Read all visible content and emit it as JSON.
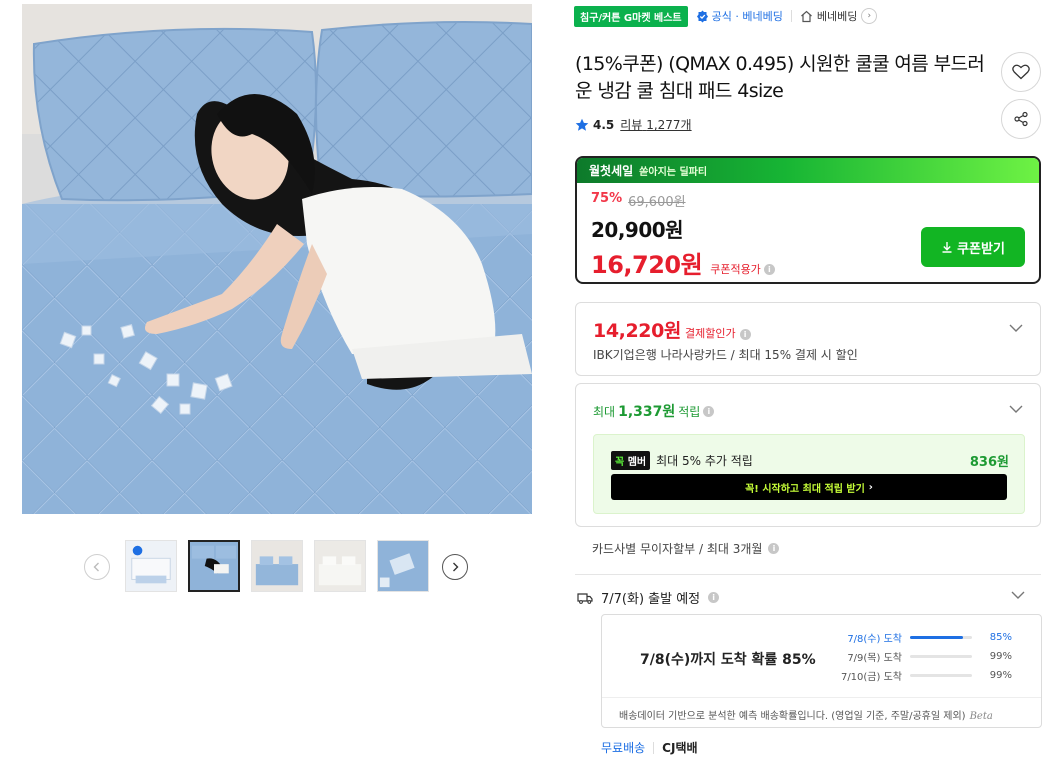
{
  "gallery": {
    "thumb_count": 5,
    "selected_index": 1
  },
  "badges": {
    "best": "침구/커튼 G마켓 베스트",
    "official": "공식 · 베네베딩",
    "store": "베네베딩"
  },
  "product": {
    "title": "(15%쿠폰) (QMAX 0.495) 시원한 쿨쿨 여름 부드러운 냉감 쿨 침대 패드 4size",
    "rating": "4.5",
    "review_label": "리뷰",
    "review_count": "1,277개"
  },
  "deal": {
    "banner_title": "월첫세일",
    "banner_sub": "쏟아지는 딜파티",
    "discount_pct": "75%",
    "original_price": "69,600원",
    "sale_price": "20,900원",
    "coupon_price": "16,720원",
    "coupon_label": "쿠폰적용가",
    "coupon_button": "쿠폰받기"
  },
  "card_discount": {
    "price": "14,220원",
    "label": "결제할인가",
    "desc": "IBK기업은행 나라사랑카드 / 최대 15% 결제 시 할인"
  },
  "points": {
    "prefix": "최대",
    "amount": "1,337원",
    "suffix": "적립",
    "member_logo_a": "꼭",
    "member_logo_b": "멤버",
    "member_text": "최대 5% 추가 적립",
    "member_points": "836원",
    "member_button": "꼭! 시작하고 최대 적립 받기"
  },
  "installment": "카드사별 무이자할부 / 최대 3개월",
  "shipping": {
    "depart": "7/7(화) 출발 예정",
    "forecast_main": "7/8(수)까지 도착 확률 85%",
    "rows": [
      {
        "date": "7/8(수) 도착",
        "pct": "85%",
        "fill": 0.85
      },
      {
        "date": "7/9(목) 도착",
        "pct": "99%",
        "fill": 0.0
      },
      {
        "date": "7/10(금) 도착",
        "pct": "99%",
        "fill": 0.0
      }
    ],
    "footnote": "배송데이터 기반으로 분석한 예측 배송확률입니다. (영업일 기준, 주말/공휴일 제외)",
    "beta": "Beta",
    "free": "무료배송",
    "carrier": "CJ택배"
  },
  "colors": {
    "accent_green": "#12b523",
    "price_red": "#e61e2d",
    "link_blue": "#1e6fe3"
  }
}
